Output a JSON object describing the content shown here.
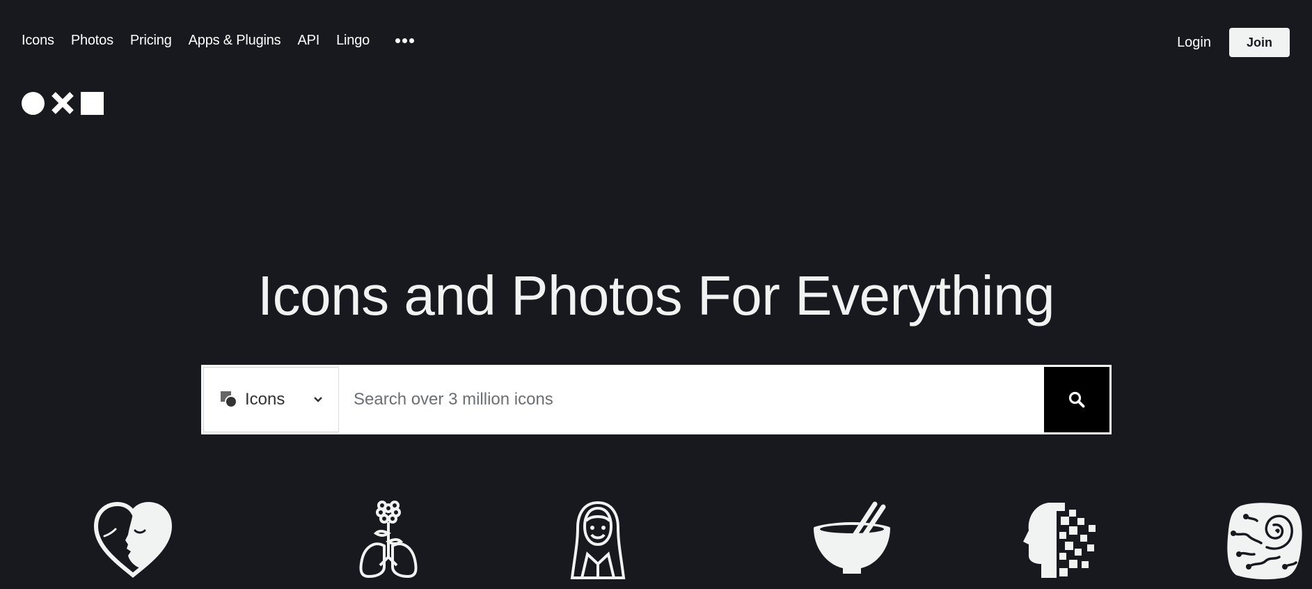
{
  "nav": {
    "links": [
      {
        "label": "Icons"
      },
      {
        "label": "Photos"
      },
      {
        "label": "Pricing"
      },
      {
        "label": "Apps & Plugins"
      },
      {
        "label": "API"
      },
      {
        "label": "Lingo"
      }
    ],
    "more_icon": "more-dots-icon",
    "login_label": "Login",
    "join_label": "Join"
  },
  "hero": {
    "title": "Icons and Photos For Everything"
  },
  "search": {
    "type_label": "Icons",
    "type_icon": "icons-type-icon",
    "placeholder": "Search over 3 million icons",
    "button_icon": "search-icon"
  },
  "showcase_icons": [
    "heart-face-icon",
    "lungs-flower-icon",
    "woman-portrait-icon",
    "bowl-chopsticks-icon",
    "pixel-head-icon",
    "ammonite-fossil-icon"
  ],
  "colors": {
    "background": "#18191e",
    "text": "#ffffff",
    "icon": "#f1f3f3",
    "search_button": "#000000"
  }
}
